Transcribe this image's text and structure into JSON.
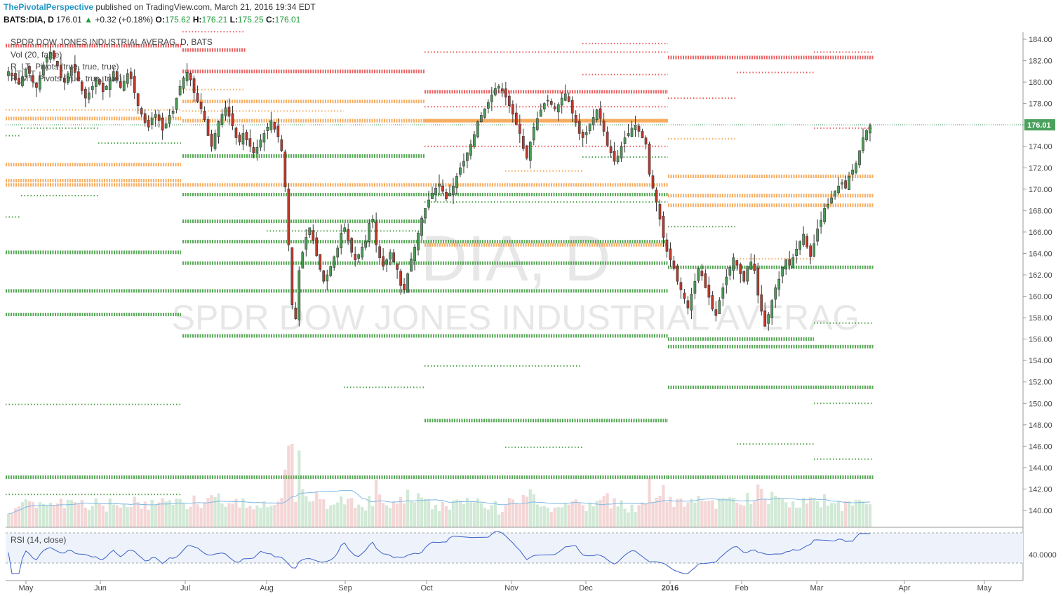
{
  "header": {
    "author": "ThePivotalPerspective",
    "published": "published on TradingView.com, March 21, 2016 19:34 EDT",
    "symbol": "BATS:DIA, D",
    "last": "176.01",
    "arrow": "▲",
    "change": "+0.32 (+0.18%)",
    "o_label": "O:",
    "o_val": "175.62",
    "h_label": "H:",
    "h_val": "176.21",
    "l_label": "L:",
    "l_val": "175.25",
    "c_label": "C:",
    "c_val": "176.01"
  },
  "legend": {
    "title": "SPDR DOW JONES INDUSTRIAL AVERAG, D, BATS",
    "vol": "Vol (20, false)",
    "lt": "R_LT_Pivots (true, true, true)",
    "mt": "R_MT_Pivots (true, true, true)",
    "rsi": "RSI (14, close)"
  },
  "watermark": {
    "big": "DIA, D",
    "sub": "SPDR DOW JONES INDUSTRIAL AVERAG"
  },
  "last_price_label": "176.01",
  "rsi_label": "40.0000",
  "colors": {
    "up": "#4c9b58",
    "down": "#c0392b",
    "red_pivot": "#e84a4a",
    "orange_pivot": "#f5a04a",
    "green_pivot": "#3a9a3a",
    "rsi_line": "#3a5fc8",
    "vol_ma": "#7fb9e6"
  },
  "chart_data": {
    "type": "candlestick",
    "price_axis_ticks": [
      "184.00",
      "182.00",
      "180.00",
      "178.00",
      "176.00",
      "174.00",
      "172.00",
      "170.00",
      "168.00",
      "166.00",
      "164.00",
      "162.00",
      "160.00",
      "158.00",
      "156.00",
      "154.00",
      "152.00",
      "150.00",
      "148.00",
      "146.00",
      "144.00",
      "142.00",
      "140.00"
    ],
    "ylim": [
      138.5,
      184.8
    ],
    "time_axis_ticks": [
      "May",
      "Jun",
      "Jul",
      "Aug",
      "Sep",
      "Oct",
      "Nov",
      "Dec",
      "2016",
      "Feb",
      "Mar",
      "Apr",
      "May"
    ],
    "close_series": [
      181.0,
      180.6,
      180.2,
      179.8,
      180.5,
      181.2,
      180.8,
      180.0,
      179.5,
      180.5,
      181.6,
      182.3,
      182.8,
      182.2,
      181.5,
      180.4,
      180.0,
      180.8,
      181.4,
      180.9,
      180.1,
      179.2,
      178.5,
      179.0,
      179.6,
      180.4,
      179.8,
      179.1,
      179.6,
      180.3,
      181.0,
      180.2,
      179.5,
      180.1,
      180.8,
      180.3,
      179.0,
      177.8,
      177.0,
      176.2,
      175.8,
      176.6,
      177.0,
      176.4,
      175.5,
      176.1,
      176.9,
      177.3,
      178.5,
      179.6,
      180.4,
      180.9,
      180.2,
      179.0,
      178.2,
      177.5,
      176.5,
      175.0,
      174.0,
      175.2,
      176.3,
      177.0,
      177.6,
      176.8,
      175.9,
      174.8,
      174.4,
      175.2,
      174.6,
      174.0,
      173.4,
      173.9,
      174.6,
      175.2,
      175.8,
      176.4,
      175.6,
      174.9,
      173.6,
      170.2,
      164.8,
      159.2,
      157.9,
      162.4,
      164.1,
      165.5,
      166.4,
      165.2,
      163.8,
      162.5,
      161.4,
      162.0,
      162.8,
      163.7,
      164.5,
      165.9,
      166.4,
      165.2,
      164.1,
      163.4,
      163.9,
      164.6,
      165.1,
      166.8,
      167.2,
      164.8,
      163.6,
      162.8,
      163.4,
      164.1,
      163.2,
      162.5,
      161.0,
      160.6,
      162.1,
      163.5,
      164.6,
      165.9,
      167.3,
      168.2,
      169.0,
      169.6,
      170.1,
      170.5,
      169.8,
      169.1,
      169.6,
      170.3,
      171.2,
      172.0,
      172.6,
      173.4,
      174.2,
      175.1,
      176.3,
      176.9,
      177.5,
      178.1,
      178.8,
      179.4,
      179.6,
      179.2,
      178.6,
      177.8,
      177.0,
      176.0,
      175.2,
      173.8,
      172.9,
      174.4,
      175.8,
      176.6,
      177.4,
      178.0,
      178.3,
      177.9,
      177.5,
      177.9,
      178.5,
      178.9,
      178.2,
      177.1,
      176.2,
      175.2,
      174.8,
      175.3,
      176.1,
      176.7,
      177.4,
      176.6,
      175.4,
      174.1,
      173.4,
      172.6,
      173.1,
      174.0,
      174.8,
      175.2,
      175.7,
      176.0,
      175.4,
      174.8,
      174.2,
      171.4,
      170.1,
      168.8,
      167.2,
      165.5,
      164.2,
      163.4,
      162.6,
      161.4,
      160.6,
      159.8,
      158.9,
      160.2,
      161.4,
      162.6,
      161.9,
      160.8,
      159.9,
      158.8,
      158.2,
      159.6,
      160.8,
      161.8,
      162.7,
      163.6,
      162.9,
      162.1,
      161.4,
      162.8,
      163.2,
      162.4,
      160.1,
      158.6,
      157.2,
      158.3,
      159.6,
      160.8,
      161.6,
      162.7,
      163.4,
      162.9,
      163.6,
      164.4,
      165.1,
      165.8,
      164.6,
      163.7,
      164.9,
      166.3,
      167.1,
      168.2,
      168.6,
      169.2,
      169.8,
      170.3,
      170.6,
      170.1,
      171.2,
      171.8,
      172.4,
      173.6,
      174.8,
      175.5,
      176.01
    ]
  }
}
